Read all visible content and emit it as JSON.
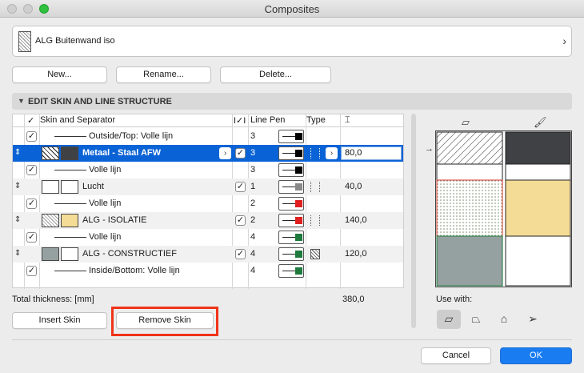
{
  "window": {
    "title": "Composites"
  },
  "composite": {
    "name": "ALG Buitenwand iso",
    "arrow": "›"
  },
  "actions": {
    "new_label": "New...",
    "rename_label": "Rename...",
    "delete_label": "Delete..."
  },
  "section": {
    "title": "EDIT SKIN AND LINE STRUCTURE",
    "toggle": "▼"
  },
  "table": {
    "headers": {
      "check": "✓",
      "skin_separator": "Skin and Separator",
      "visibility": "I✓I",
      "line_pen": "Line Pen",
      "type": "Type",
      "thickness_icon": "⌶"
    },
    "rows": [
      {
        "kind": "separator",
        "label": "Outside/Top: Volle lijn",
        "pen": "3",
        "checked": true,
        "pen_color": "#000000"
      },
      {
        "kind": "skin",
        "label": "Metaal - Staal AFW",
        "pen": "3",
        "thickness": "80,0",
        "selected": true,
        "more": "›",
        "pen_color": "#000000",
        "fill_color": "#3f4144"
      },
      {
        "kind": "separator",
        "label": "Volle lijn",
        "pen": "3",
        "checked": true,
        "pen_color": "#000000"
      },
      {
        "kind": "skin",
        "label": "Lucht",
        "pen": "1",
        "thickness": "40,0",
        "pen_color": "#888888",
        "fill_color": "#ffffff"
      },
      {
        "kind": "separator",
        "label": "Volle lijn",
        "pen": "2",
        "checked": true,
        "pen_color": "#e02020"
      },
      {
        "kind": "skin",
        "label": "ALG - ISOLATIE",
        "pen": "2",
        "thickness": "140,0",
        "pen_color": "#e02020",
        "fill_color": "#f5dc96"
      },
      {
        "kind": "separator",
        "label": "Volle lijn",
        "pen": "4",
        "checked": true,
        "pen_color": "#1d7a3c"
      },
      {
        "kind": "skin",
        "label": "ALG - CONSTRUCTIEF",
        "pen": "4",
        "thickness": "120,0",
        "pen_color": "#1d7a3c",
        "fill_color": "#95a0a0"
      },
      {
        "kind": "separator",
        "label": "Inside/Bottom: Volle lijn",
        "pen": "4",
        "checked": true,
        "pen_color": "#1d7a3c"
      }
    ]
  },
  "total": {
    "label": "Total thickness: [mm]",
    "value": "380,0"
  },
  "skin_buttons": {
    "insert_label": "Insert Skin",
    "remove_label": "Remove Skin"
  },
  "preview": {
    "icons": {
      "pattern": "▱",
      "fill": "🖌"
    },
    "use_with_label": "Use with:",
    "use_with_icons": [
      "wall-icon",
      "slab-icon",
      "roof-icon",
      "shell-icon"
    ]
  },
  "footer": {
    "cancel_label": "Cancel",
    "ok_label": "OK"
  },
  "colors": {
    "accent": "#1a7cf1",
    "selection": "#0a63d6",
    "highlight": "#f0331a"
  }
}
